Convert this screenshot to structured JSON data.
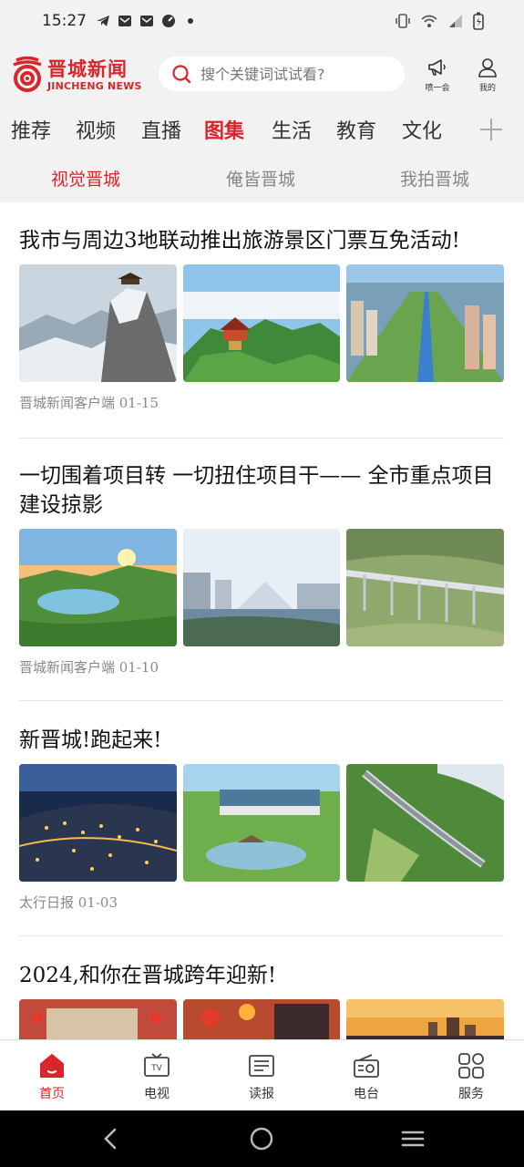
{
  "status_bar": {
    "time": "15:27",
    "left_icons": [
      "telegram-icon",
      "mail-icon",
      "mail-icon",
      "gauge-icon",
      "dot-icon"
    ],
    "right_icons": [
      "vibrate-icon",
      "wifi-icon",
      "signal-icon",
      "battery-icon"
    ]
  },
  "header": {
    "logo_cn": "晋城新闻",
    "logo_en": "JINCHENG NEWS",
    "search_placeholder": "搜个关键词试试看?",
    "shout_label": "喷一会",
    "profile_label": "我的"
  },
  "channels": {
    "items": [
      "推荐",
      "视频",
      "直播",
      "图集",
      "生活",
      "教育",
      "文化"
    ],
    "active": "图集"
  },
  "subtabs": {
    "items": [
      "视觉晋城",
      "俺皆晋城",
      "我拍晋城"
    ],
    "active": "视觉晋城"
  },
  "articles": [
    {
      "title": "我市与周边3地联动推出旅游景区门票互免活动!",
      "meta": "晋城新闻客户端 01-15",
      "images": [
        "snowy-mountain-pavilion",
        "pagoda-above-clouds",
        "city-aerial-river"
      ]
    },
    {
      "title": "一切围着项目转 一切扭住项目干—— 全市重点项目建设掠影",
      "meta": "晋城新闻客户端 01-10",
      "images": [
        "sunset-lake-park",
        "modern-riverside-buildings",
        "highway-bridge-valley"
      ]
    },
    {
      "title": "新晋城!跑起来!",
      "meta": "太行日报 01-03",
      "images": [
        "city-night-lights",
        "park-lake-pavilion",
        "curving-road-hills"
      ]
    },
    {
      "title": "2024,和你在晋城跨年迎新!",
      "meta": "",
      "images": [
        "new-year-street",
        "lanterns-crowd",
        "sunset-skyline"
      ]
    }
  ],
  "bottom_nav": {
    "items": [
      {
        "label": "首页",
        "icon": "home-icon"
      },
      {
        "label": "电视",
        "icon": "tv-icon"
      },
      {
        "label": "读报",
        "icon": "newspaper-icon"
      },
      {
        "label": "电台",
        "icon": "radio-icon"
      },
      {
        "label": "服务",
        "icon": "services-icon"
      }
    ],
    "active": "首页"
  },
  "colors": {
    "accent": "#d8262a",
    "background": "#f2f2f2",
    "text": "#222222",
    "meta": "#888888"
  }
}
